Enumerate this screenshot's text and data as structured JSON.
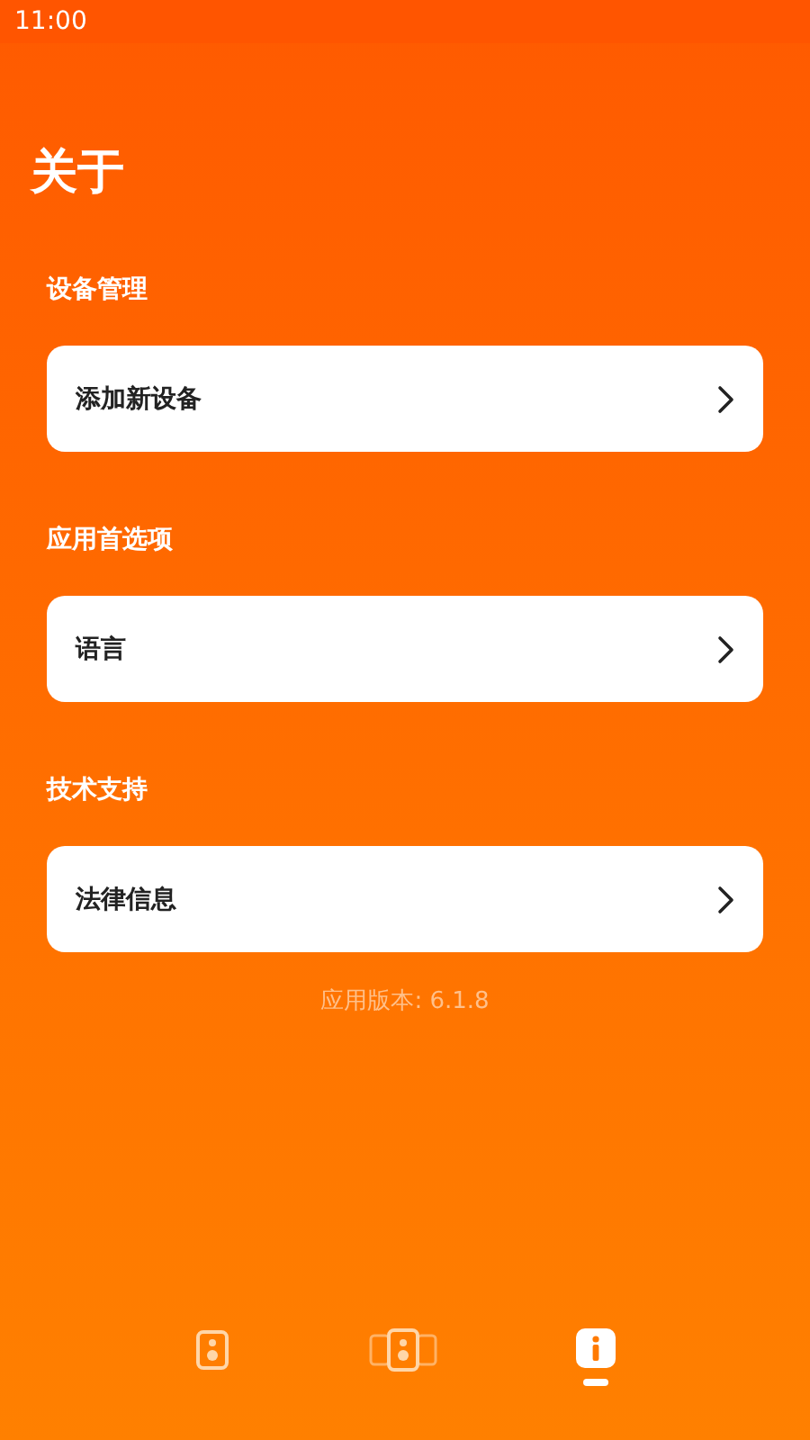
{
  "status_bar": {
    "time": "11:00"
  },
  "title": "关于",
  "sections": [
    {
      "label": "设备管理",
      "items": [
        {
          "label": "添加新设备"
        }
      ]
    },
    {
      "label": "应用首选项",
      "items": [
        {
          "label": "语言"
        }
      ]
    },
    {
      "label": "技术支持",
      "items": [
        {
          "label": "法律信息"
        }
      ]
    }
  ],
  "version": "应用版本: 6.1.8",
  "nav_tabs": [
    {
      "kind": "speaker",
      "selected": false
    },
    {
      "kind": "speaker-group",
      "selected": false
    },
    {
      "kind": "info",
      "selected": true
    }
  ]
}
